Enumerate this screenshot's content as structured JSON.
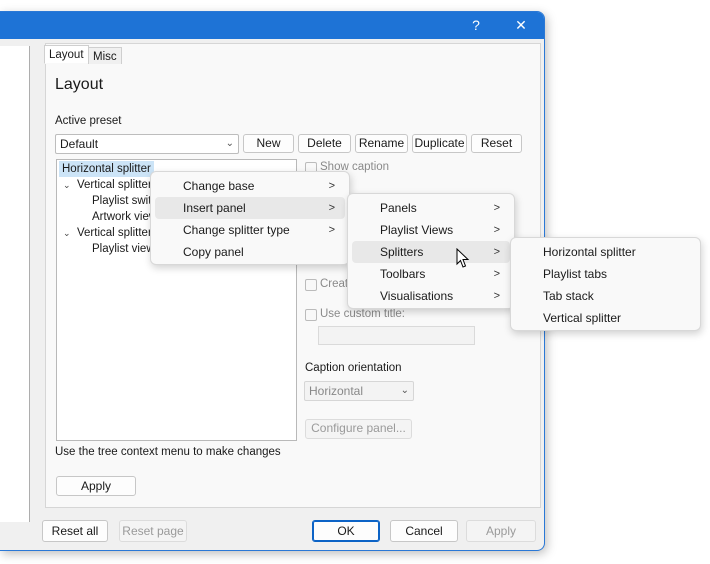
{
  "window": {
    "help_label": "?",
    "close_label": "✕"
  },
  "tabs": [
    {
      "label": "Layout"
    },
    {
      "label": "Misc"
    }
  ],
  "layout": {
    "heading": "Layout",
    "active_preset_label": "Active preset",
    "preset_value": "Default",
    "buttons": {
      "new": "New",
      "delete": "Delete",
      "rename": "Rename",
      "duplicate": "Duplicate",
      "reset": "Reset"
    },
    "tree": [
      {
        "label": "Horizontal splitter"
      },
      {
        "label": "Vertical splitter"
      },
      {
        "label": "Playlist switc"
      },
      {
        "label": "Artwork view"
      },
      {
        "label": "Vertical splitter"
      },
      {
        "label": "Playlist view"
      }
    ],
    "show_caption": "Show caption",
    "create_label": "Creat",
    "use_custom_title": "Use custom title:",
    "caption_orientation_label": "Caption orientation",
    "caption_orientation_value": "Horizontal",
    "configure_panel": "Configure panel...",
    "hint": "Use the tree context menu to make changes",
    "apply": "Apply"
  },
  "footer": {
    "reset_all": "Reset all",
    "reset_page": "Reset page",
    "ok": "OK",
    "cancel": "Cancel",
    "apply": "Apply"
  },
  "context_menu": [
    {
      "label": "Change base",
      "has_submenu": true
    },
    {
      "label": "Insert panel",
      "has_submenu": true
    },
    {
      "label": "Change splitter type",
      "has_submenu": true
    },
    {
      "label": "Copy panel",
      "has_submenu": false
    }
  ],
  "insert_panel_menu": [
    {
      "label": "Panels"
    },
    {
      "label": "Playlist Views"
    },
    {
      "label": "Splitters"
    },
    {
      "label": "Toolbars"
    },
    {
      "label": "Visualisations"
    }
  ],
  "splitters_menu": [
    {
      "label": "Horizontal splitter"
    },
    {
      "label": "Playlist tabs"
    },
    {
      "label": "Tab stack"
    },
    {
      "label": "Vertical splitter"
    }
  ],
  "submenu_glyph": ">",
  "colors": {
    "accent": "#1e73d6",
    "selection": "#cce4f7"
  }
}
